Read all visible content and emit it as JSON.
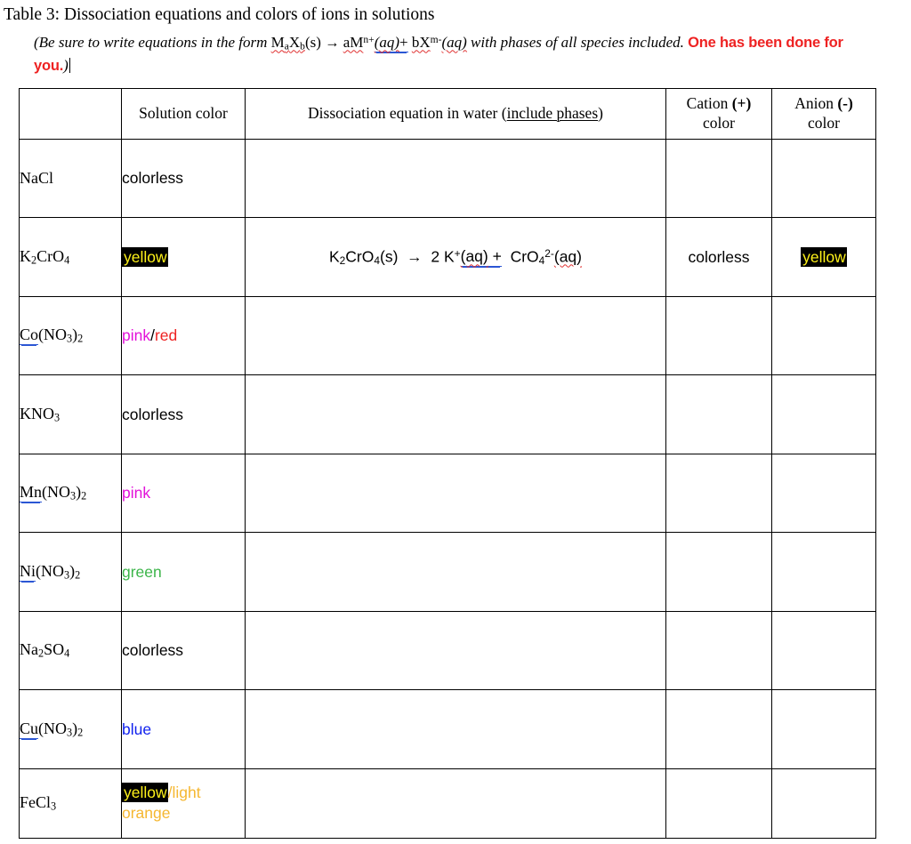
{
  "document": {
    "title": "Table 3: Dissociation equations and colors of ions in solutions",
    "instructions": {
      "lead": "(Be sure to write equations in the form ",
      "formula_M": "M",
      "formula_a": "a",
      "formula_X": "X",
      "formula_b": "b",
      "formula_s": "(s)",
      "arrow": "→",
      "left_ion": "aM",
      "left_charge": "n+",
      "left_phase": "(aq)",
      "plus": "+",
      "right_ion": "bX",
      "right_charge": "m-",
      "right_phase": "(aq)",
      "tail": " with phases of all species included. ",
      "red_text": "One has been done for you.",
      "closing_paren": ")"
    }
  },
  "colors": {
    "red": "#EE2222",
    "magenta": "#E312D9",
    "green": "#3CB54A",
    "blue": "#1122EE",
    "orange": "#F5B731",
    "highlight_bg": "#000000",
    "highlight_fg": "#FFF21A",
    "grammar_underline": "#2b56d4",
    "spellcheck_underline": "#E03030"
  },
  "table": {
    "headers": [
      "",
      "Solution color",
      "Dissociation equation in water (include phases)",
      "Cation (+)\ncolor",
      "Anion (-)\ncolor"
    ],
    "header_parts": {
      "dissociation_plain": "Dissociation equation in water (",
      "dissociation_underlined": "include phases",
      "dissociation_close": ")",
      "cation_word": "Cation",
      "cation_sign": "(+)",
      "anion_word": "Anion",
      "anion_sign": "(-)",
      "color_word": "color"
    },
    "rows": [
      {
        "compound": "NaCl",
        "compound_parts": {
          "pre": "NaCl",
          "sub1": "",
          "mid": "",
          "sub2": ""
        },
        "solution_color": "colorless",
        "equation": "",
        "cation_color": "",
        "anion_color": ""
      },
      {
        "compound": "K2CrO4",
        "solution_color": "yellow",
        "equation": "K2CrO4(s) → 2 K+(aq) + CrO4 2-(aq)",
        "equation_parts": {
          "reactant": "K",
          "reactant_sub1": "2",
          "reactant_mid": "CrO",
          "reactant_sub2": "4",
          "reactant_phase": "(s)",
          "arrow": "→",
          "coeff": "2",
          "cation": "K",
          "cation_charge": "+",
          "cation_phase": "(aq)",
          "plus": "+",
          "anion": "CrO",
          "anion_sub": "4",
          "anion_charge": "2-",
          "anion_phase": "(aq)"
        },
        "cation_color": "colorless",
        "anion_color": "yellow"
      },
      {
        "compound": "Co(NO3)2",
        "solution_color": "pink/red",
        "equation": "",
        "cation_color": "",
        "anion_color": ""
      },
      {
        "compound": "KNO3",
        "solution_color": "colorless",
        "equation": "",
        "cation_color": "",
        "anion_color": ""
      },
      {
        "compound": "Mn(NO3)2",
        "solution_color": "pink",
        "equation": "",
        "cation_color": "",
        "anion_color": ""
      },
      {
        "compound": "Ni(NO3)2",
        "solution_color": "green",
        "equation": "",
        "cation_color": "",
        "anion_color": ""
      },
      {
        "compound": "Na2SO4",
        "solution_color": "colorless",
        "equation": "",
        "cation_color": "",
        "anion_color": ""
      },
      {
        "compound": "Cu(NO3)2",
        "solution_color": "blue",
        "equation": "",
        "cation_color": "",
        "anion_color": ""
      },
      {
        "compound": "FeCl3",
        "solution_color": "yellow/light orange",
        "equation": "",
        "cation_color": "",
        "anion_color": ""
      }
    ],
    "cell_text": {
      "r1_solution": "colorless",
      "r2_solution": "yellow",
      "r2_cation": "colorless",
      "r2_anion": "yellow",
      "r3_solution_a": "pink",
      "r3_solution_sep": "/",
      "r3_solution_b": "red",
      "r4_solution": "colorless",
      "r5_solution": "pink",
      "r6_solution": "green",
      "r7_solution": "colorless",
      "r8_solution": "blue",
      "r9_solution_a": "yellow",
      "r9_solution_b": "/light orange"
    },
    "formulas": {
      "f1": {
        "el": "NaCl"
      },
      "f2": {
        "a": "K",
        "s1": "2",
        "b": "CrO",
        "s2": "4"
      },
      "f3": {
        "a": "Co",
        "b": "(NO",
        "s1": "3",
        "c": ")",
        "s2": "2"
      },
      "f4": {
        "a": "KNO",
        "s1": "3"
      },
      "f5": {
        "a": "Mn",
        "b": "(NO",
        "s1": "3",
        "c": ")",
        "s2": "2"
      },
      "f6": {
        "a": "Ni",
        "b": "(NO",
        "s1": "3",
        "c": ")",
        "s2": "2"
      },
      "f7": {
        "a": "Na",
        "s1": "2",
        "b": "SO",
        "s2": "4"
      },
      "f8": {
        "a": "Cu",
        "b": "(NO",
        "s1": "3",
        "c": ")",
        "s2": "2"
      },
      "f9": {
        "a": "FeCl",
        "s1": "3"
      }
    }
  }
}
